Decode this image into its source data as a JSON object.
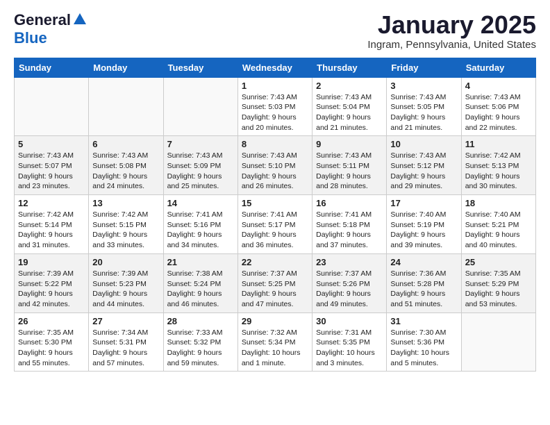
{
  "header": {
    "logo_line1": "General",
    "logo_line2": "Blue",
    "month": "January 2025",
    "location": "Ingram, Pennsylvania, United States"
  },
  "weekdays": [
    "Sunday",
    "Monday",
    "Tuesday",
    "Wednesday",
    "Thursday",
    "Friday",
    "Saturday"
  ],
  "weeks": [
    [
      {
        "day": "",
        "info": ""
      },
      {
        "day": "",
        "info": ""
      },
      {
        "day": "",
        "info": ""
      },
      {
        "day": "1",
        "info": "Sunrise: 7:43 AM\nSunset: 5:03 PM\nDaylight: 9 hours\nand 20 minutes."
      },
      {
        "day": "2",
        "info": "Sunrise: 7:43 AM\nSunset: 5:04 PM\nDaylight: 9 hours\nand 21 minutes."
      },
      {
        "day": "3",
        "info": "Sunrise: 7:43 AM\nSunset: 5:05 PM\nDaylight: 9 hours\nand 21 minutes."
      },
      {
        "day": "4",
        "info": "Sunrise: 7:43 AM\nSunset: 5:06 PM\nDaylight: 9 hours\nand 22 minutes."
      }
    ],
    [
      {
        "day": "5",
        "info": "Sunrise: 7:43 AM\nSunset: 5:07 PM\nDaylight: 9 hours\nand 23 minutes."
      },
      {
        "day": "6",
        "info": "Sunrise: 7:43 AM\nSunset: 5:08 PM\nDaylight: 9 hours\nand 24 minutes."
      },
      {
        "day": "7",
        "info": "Sunrise: 7:43 AM\nSunset: 5:09 PM\nDaylight: 9 hours\nand 25 minutes."
      },
      {
        "day": "8",
        "info": "Sunrise: 7:43 AM\nSunset: 5:10 PM\nDaylight: 9 hours\nand 26 minutes."
      },
      {
        "day": "9",
        "info": "Sunrise: 7:43 AM\nSunset: 5:11 PM\nDaylight: 9 hours\nand 28 minutes."
      },
      {
        "day": "10",
        "info": "Sunrise: 7:43 AM\nSunset: 5:12 PM\nDaylight: 9 hours\nand 29 minutes."
      },
      {
        "day": "11",
        "info": "Sunrise: 7:42 AM\nSunset: 5:13 PM\nDaylight: 9 hours\nand 30 minutes."
      }
    ],
    [
      {
        "day": "12",
        "info": "Sunrise: 7:42 AM\nSunset: 5:14 PM\nDaylight: 9 hours\nand 31 minutes."
      },
      {
        "day": "13",
        "info": "Sunrise: 7:42 AM\nSunset: 5:15 PM\nDaylight: 9 hours\nand 33 minutes."
      },
      {
        "day": "14",
        "info": "Sunrise: 7:41 AM\nSunset: 5:16 PM\nDaylight: 9 hours\nand 34 minutes."
      },
      {
        "day": "15",
        "info": "Sunrise: 7:41 AM\nSunset: 5:17 PM\nDaylight: 9 hours\nand 36 minutes."
      },
      {
        "day": "16",
        "info": "Sunrise: 7:41 AM\nSunset: 5:18 PM\nDaylight: 9 hours\nand 37 minutes."
      },
      {
        "day": "17",
        "info": "Sunrise: 7:40 AM\nSunset: 5:19 PM\nDaylight: 9 hours\nand 39 minutes."
      },
      {
        "day": "18",
        "info": "Sunrise: 7:40 AM\nSunset: 5:21 PM\nDaylight: 9 hours\nand 40 minutes."
      }
    ],
    [
      {
        "day": "19",
        "info": "Sunrise: 7:39 AM\nSunset: 5:22 PM\nDaylight: 9 hours\nand 42 minutes."
      },
      {
        "day": "20",
        "info": "Sunrise: 7:39 AM\nSunset: 5:23 PM\nDaylight: 9 hours\nand 44 minutes."
      },
      {
        "day": "21",
        "info": "Sunrise: 7:38 AM\nSunset: 5:24 PM\nDaylight: 9 hours\nand 46 minutes."
      },
      {
        "day": "22",
        "info": "Sunrise: 7:37 AM\nSunset: 5:25 PM\nDaylight: 9 hours\nand 47 minutes."
      },
      {
        "day": "23",
        "info": "Sunrise: 7:37 AM\nSunset: 5:26 PM\nDaylight: 9 hours\nand 49 minutes."
      },
      {
        "day": "24",
        "info": "Sunrise: 7:36 AM\nSunset: 5:28 PM\nDaylight: 9 hours\nand 51 minutes."
      },
      {
        "day": "25",
        "info": "Sunrise: 7:35 AM\nSunset: 5:29 PM\nDaylight: 9 hours\nand 53 minutes."
      }
    ],
    [
      {
        "day": "26",
        "info": "Sunrise: 7:35 AM\nSunset: 5:30 PM\nDaylight: 9 hours\nand 55 minutes."
      },
      {
        "day": "27",
        "info": "Sunrise: 7:34 AM\nSunset: 5:31 PM\nDaylight: 9 hours\nand 57 minutes."
      },
      {
        "day": "28",
        "info": "Sunrise: 7:33 AM\nSunset: 5:32 PM\nDaylight: 9 hours\nand 59 minutes."
      },
      {
        "day": "29",
        "info": "Sunrise: 7:32 AM\nSunset: 5:34 PM\nDaylight: 10 hours\nand 1 minute."
      },
      {
        "day": "30",
        "info": "Sunrise: 7:31 AM\nSunset: 5:35 PM\nDaylight: 10 hours\nand 3 minutes."
      },
      {
        "day": "31",
        "info": "Sunrise: 7:30 AM\nSunset: 5:36 PM\nDaylight: 10 hours\nand 5 minutes."
      },
      {
        "day": "",
        "info": ""
      }
    ]
  ]
}
